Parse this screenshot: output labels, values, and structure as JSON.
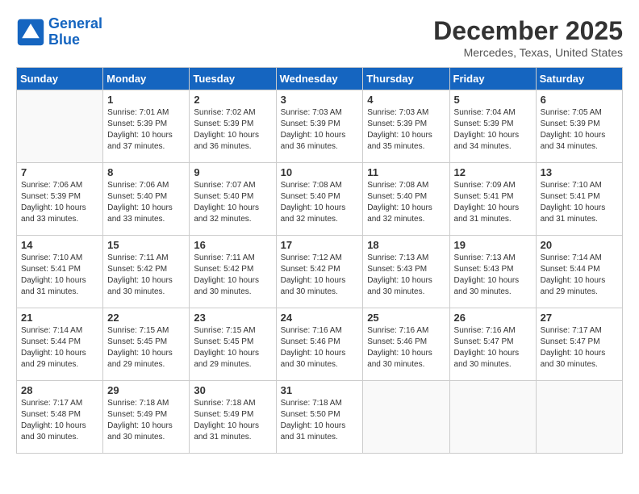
{
  "header": {
    "logo_line1": "General",
    "logo_line2": "Blue",
    "month_title": "December 2025",
    "location": "Mercedes, Texas, United States"
  },
  "weekdays": [
    "Sunday",
    "Monday",
    "Tuesday",
    "Wednesday",
    "Thursday",
    "Friday",
    "Saturday"
  ],
  "weeks": [
    [
      {
        "day": "",
        "info": ""
      },
      {
        "day": "1",
        "info": "Sunrise: 7:01 AM\nSunset: 5:39 PM\nDaylight: 10 hours\nand 37 minutes."
      },
      {
        "day": "2",
        "info": "Sunrise: 7:02 AM\nSunset: 5:39 PM\nDaylight: 10 hours\nand 36 minutes."
      },
      {
        "day": "3",
        "info": "Sunrise: 7:03 AM\nSunset: 5:39 PM\nDaylight: 10 hours\nand 36 minutes."
      },
      {
        "day": "4",
        "info": "Sunrise: 7:03 AM\nSunset: 5:39 PM\nDaylight: 10 hours\nand 35 minutes."
      },
      {
        "day": "5",
        "info": "Sunrise: 7:04 AM\nSunset: 5:39 PM\nDaylight: 10 hours\nand 34 minutes."
      },
      {
        "day": "6",
        "info": "Sunrise: 7:05 AM\nSunset: 5:39 PM\nDaylight: 10 hours\nand 34 minutes."
      }
    ],
    [
      {
        "day": "7",
        "info": "Sunrise: 7:06 AM\nSunset: 5:39 PM\nDaylight: 10 hours\nand 33 minutes."
      },
      {
        "day": "8",
        "info": "Sunrise: 7:06 AM\nSunset: 5:40 PM\nDaylight: 10 hours\nand 33 minutes."
      },
      {
        "day": "9",
        "info": "Sunrise: 7:07 AM\nSunset: 5:40 PM\nDaylight: 10 hours\nand 32 minutes."
      },
      {
        "day": "10",
        "info": "Sunrise: 7:08 AM\nSunset: 5:40 PM\nDaylight: 10 hours\nand 32 minutes."
      },
      {
        "day": "11",
        "info": "Sunrise: 7:08 AM\nSunset: 5:40 PM\nDaylight: 10 hours\nand 32 minutes."
      },
      {
        "day": "12",
        "info": "Sunrise: 7:09 AM\nSunset: 5:41 PM\nDaylight: 10 hours\nand 31 minutes."
      },
      {
        "day": "13",
        "info": "Sunrise: 7:10 AM\nSunset: 5:41 PM\nDaylight: 10 hours\nand 31 minutes."
      }
    ],
    [
      {
        "day": "14",
        "info": "Sunrise: 7:10 AM\nSunset: 5:41 PM\nDaylight: 10 hours\nand 31 minutes."
      },
      {
        "day": "15",
        "info": "Sunrise: 7:11 AM\nSunset: 5:42 PM\nDaylight: 10 hours\nand 30 minutes."
      },
      {
        "day": "16",
        "info": "Sunrise: 7:11 AM\nSunset: 5:42 PM\nDaylight: 10 hours\nand 30 minutes."
      },
      {
        "day": "17",
        "info": "Sunrise: 7:12 AM\nSunset: 5:42 PM\nDaylight: 10 hours\nand 30 minutes."
      },
      {
        "day": "18",
        "info": "Sunrise: 7:13 AM\nSunset: 5:43 PM\nDaylight: 10 hours\nand 30 minutes."
      },
      {
        "day": "19",
        "info": "Sunrise: 7:13 AM\nSunset: 5:43 PM\nDaylight: 10 hours\nand 30 minutes."
      },
      {
        "day": "20",
        "info": "Sunrise: 7:14 AM\nSunset: 5:44 PM\nDaylight: 10 hours\nand 29 minutes."
      }
    ],
    [
      {
        "day": "21",
        "info": "Sunrise: 7:14 AM\nSunset: 5:44 PM\nDaylight: 10 hours\nand 29 minutes."
      },
      {
        "day": "22",
        "info": "Sunrise: 7:15 AM\nSunset: 5:45 PM\nDaylight: 10 hours\nand 29 minutes."
      },
      {
        "day": "23",
        "info": "Sunrise: 7:15 AM\nSunset: 5:45 PM\nDaylight: 10 hours\nand 29 minutes."
      },
      {
        "day": "24",
        "info": "Sunrise: 7:16 AM\nSunset: 5:46 PM\nDaylight: 10 hours\nand 30 minutes."
      },
      {
        "day": "25",
        "info": "Sunrise: 7:16 AM\nSunset: 5:46 PM\nDaylight: 10 hours\nand 30 minutes."
      },
      {
        "day": "26",
        "info": "Sunrise: 7:16 AM\nSunset: 5:47 PM\nDaylight: 10 hours\nand 30 minutes."
      },
      {
        "day": "27",
        "info": "Sunrise: 7:17 AM\nSunset: 5:47 PM\nDaylight: 10 hours\nand 30 minutes."
      }
    ],
    [
      {
        "day": "28",
        "info": "Sunrise: 7:17 AM\nSunset: 5:48 PM\nDaylight: 10 hours\nand 30 minutes."
      },
      {
        "day": "29",
        "info": "Sunrise: 7:18 AM\nSunset: 5:49 PM\nDaylight: 10 hours\nand 30 minutes."
      },
      {
        "day": "30",
        "info": "Sunrise: 7:18 AM\nSunset: 5:49 PM\nDaylight: 10 hours\nand 31 minutes."
      },
      {
        "day": "31",
        "info": "Sunrise: 7:18 AM\nSunset: 5:50 PM\nDaylight: 10 hours\nand 31 minutes."
      },
      {
        "day": "",
        "info": ""
      },
      {
        "day": "",
        "info": ""
      },
      {
        "day": "",
        "info": ""
      }
    ]
  ]
}
